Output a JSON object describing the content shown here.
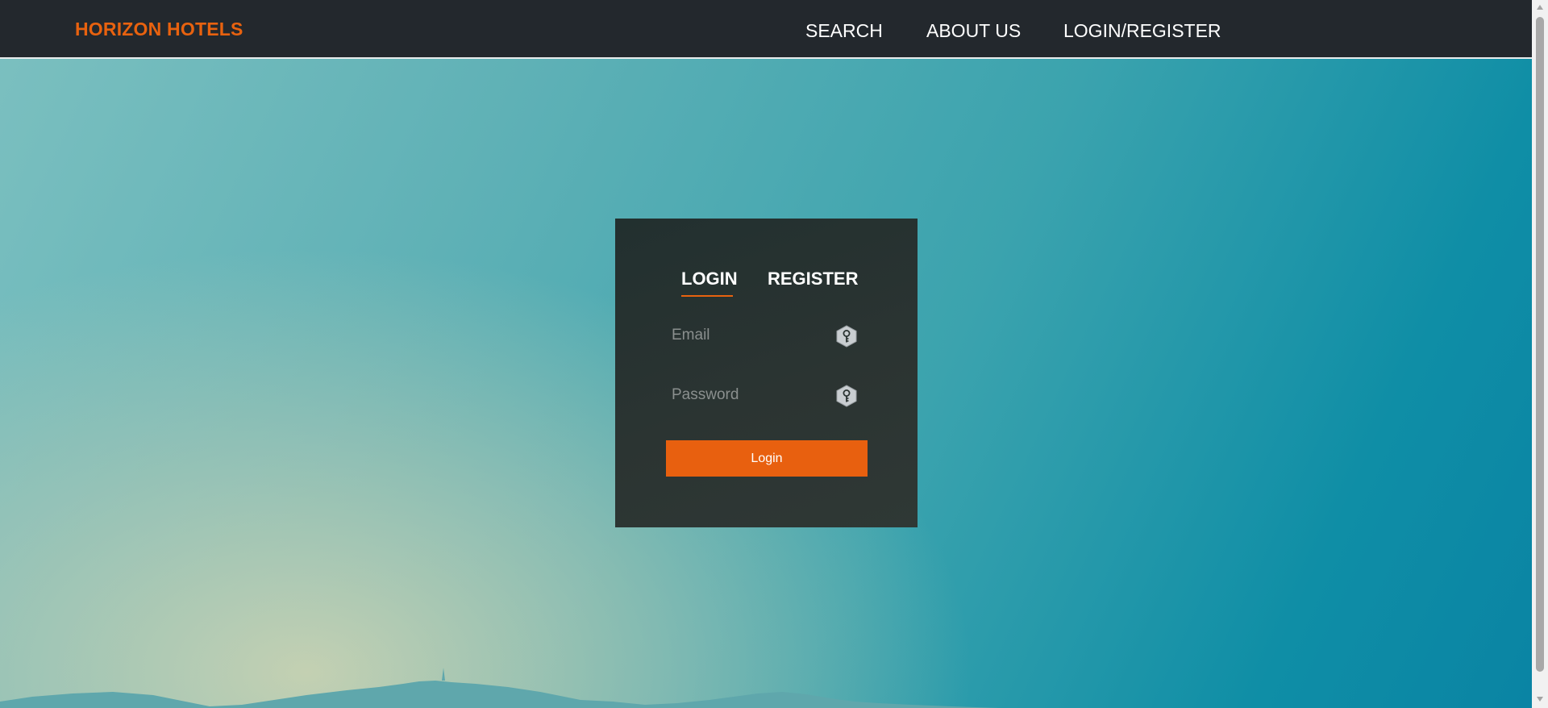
{
  "navbar": {
    "brand": "HORIZON HOTELS",
    "links": [
      "SEARCH",
      "ABOUT US",
      "LOGIN/REGISTER"
    ]
  },
  "auth": {
    "tabs": [
      "LOGIN",
      "REGISTER"
    ],
    "active_tab": "LOGIN",
    "email_placeholder": "Email",
    "email_value": "",
    "password_placeholder": "Password",
    "password_value": "",
    "field_icon": "key-icon",
    "submit_label": "Login"
  },
  "colors": {
    "accent": "#e8620f",
    "navbar_bg": "#23282d",
    "card_bg": "#2b3432"
  }
}
